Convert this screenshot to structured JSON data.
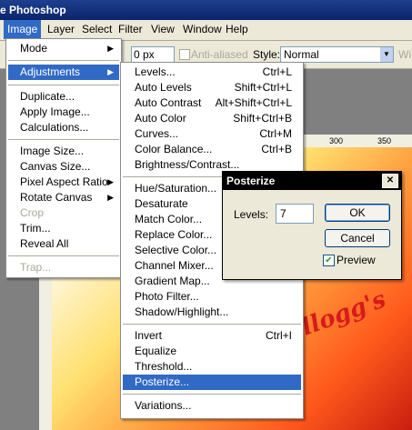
{
  "app": {
    "title": "e Photoshop"
  },
  "menubar": [
    {
      "label": "Image",
      "active": true
    },
    {
      "label": "Layer"
    },
    {
      "label": "Select"
    },
    {
      "label": "Filter"
    },
    {
      "label": "View"
    },
    {
      "label": "Window"
    },
    {
      "label": "Help"
    }
  ],
  "optionsbar": {
    "feather_value": "0 px",
    "antialias_label": "Anti-aliased",
    "style_label": "Style:",
    "style_value": "Normal",
    "width_label_partial": "Wi"
  },
  "ruler": {
    "h_ticks": [
      "300",
      "350"
    ]
  },
  "image_menu": [
    {
      "label": "Mode",
      "submenu": true
    },
    {
      "separator": true
    },
    {
      "label": "Adjustments",
      "submenu": true,
      "highlighted": true
    },
    {
      "separator": true
    },
    {
      "label": "Duplicate..."
    },
    {
      "label": "Apply Image..."
    },
    {
      "label": "Calculations..."
    },
    {
      "separator": true
    },
    {
      "label": "Image Size..."
    },
    {
      "label": "Canvas Size..."
    },
    {
      "label": "Pixel Aspect Ratio",
      "submenu": true
    },
    {
      "label": "Rotate Canvas",
      "submenu": true
    },
    {
      "label": "Crop",
      "disabled": true
    },
    {
      "label": "Trim..."
    },
    {
      "label": "Reveal All"
    },
    {
      "separator": true
    },
    {
      "label": "Trap...",
      "disabled": true
    }
  ],
  "adjustments_menu": [
    {
      "label": "Levels...",
      "shortcut": "Ctrl+L"
    },
    {
      "label": "Auto Levels",
      "shortcut": "Shift+Ctrl+L"
    },
    {
      "label": "Auto Contrast",
      "shortcut": "Alt+Shift+Ctrl+L"
    },
    {
      "label": "Auto Color",
      "shortcut": "Shift+Ctrl+B"
    },
    {
      "label": "Curves...",
      "shortcut": "Ctrl+M"
    },
    {
      "label": "Color Balance...",
      "shortcut": "Ctrl+B"
    },
    {
      "label": "Brightness/Contrast..."
    },
    {
      "separator": true
    },
    {
      "label": "Hue/Saturation..."
    },
    {
      "label": "Desaturate"
    },
    {
      "label": "Match Color..."
    },
    {
      "label": "Replace Color..."
    },
    {
      "label": "Selective Color..."
    },
    {
      "label": "Channel Mixer..."
    },
    {
      "label": "Gradient Map..."
    },
    {
      "label": "Photo Filter..."
    },
    {
      "label": "Shadow/Highlight..."
    },
    {
      "separator": true
    },
    {
      "label": "Invert",
      "shortcut": "Ctrl+I"
    },
    {
      "label": "Equalize"
    },
    {
      "label": "Threshold..."
    },
    {
      "label": "Posterize...",
      "highlighted": true
    },
    {
      "separator": true
    },
    {
      "label": "Variations..."
    }
  ],
  "posterize_dialog": {
    "title": "Posterize",
    "levels_label": "Levels:",
    "levels_value": "7",
    "ok_label": "OK",
    "cancel_label": "Cancel",
    "preview_label": "Preview",
    "preview_checked": true
  },
  "photo": {
    "text": "llogg's"
  }
}
